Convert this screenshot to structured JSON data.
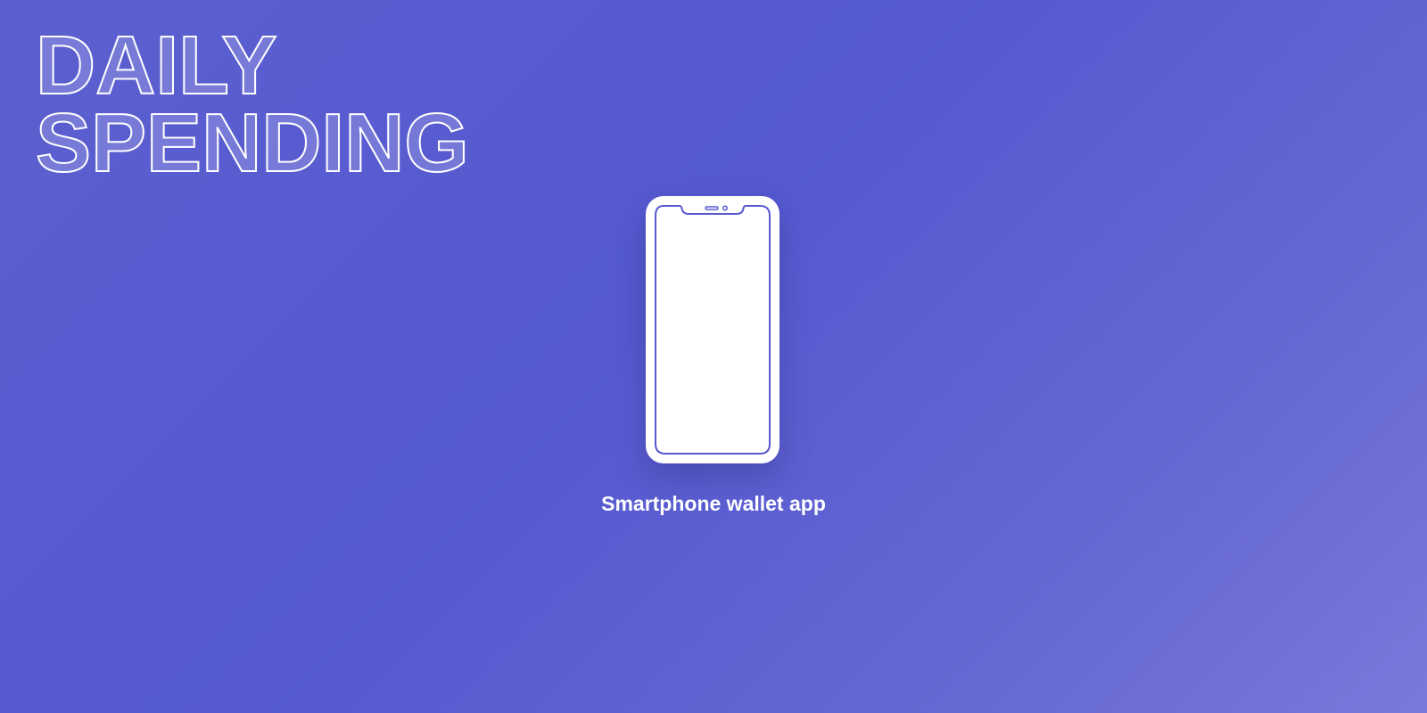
{
  "heading": {
    "line1": "DAILY",
    "line2": "SPENDING"
  },
  "caption": "Smartphone wallet app",
  "colors": {
    "accent": "#5659d0",
    "foreground": "#ffffff"
  },
  "icons": {
    "device": "smartphone-icon"
  }
}
